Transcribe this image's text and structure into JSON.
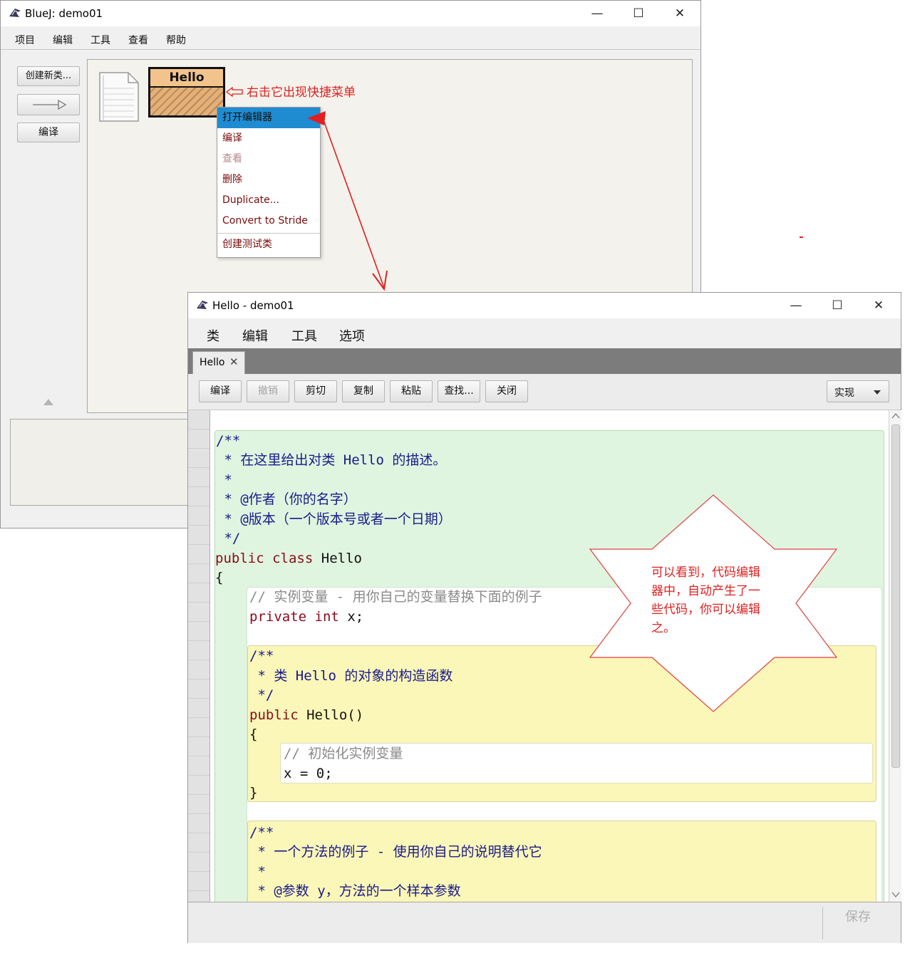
{
  "main_window": {
    "title": "BlueJ:  demo01",
    "menu": [
      "项目",
      "编辑",
      "工具",
      "查看",
      "帮助"
    ],
    "side_buttons": {
      "new_class": "创建新类...",
      "arrow": "—▷",
      "compile": "编译"
    },
    "class_box_label": "Hello"
  },
  "context_menu": {
    "items": [
      {
        "label": "打开编辑器",
        "state": "highlighted"
      },
      {
        "label": "编译",
        "state": "normal"
      },
      {
        "label": "查看",
        "state": "disabled"
      },
      {
        "label": "删除",
        "state": "normal"
      },
      {
        "label": "Duplicate...",
        "state": "normal"
      },
      {
        "label": "Convert to Stride",
        "state": "normal"
      },
      {
        "label": "创建测试类",
        "state": "normal"
      }
    ]
  },
  "annotations": {
    "right_click_note": "右击它出现快捷菜单",
    "star_note_lines": [
      "可以看到，代码编辑",
      "器中，自动产生了一",
      "些代码，你可以编辑",
      "之。"
    ]
  },
  "editor_window": {
    "title": "Hello - demo01",
    "menu": [
      "类",
      "编辑",
      "工具",
      "选项"
    ],
    "tab": "Hello",
    "toolbar": {
      "buttons": [
        "编译",
        "撤销",
        "剪切",
        "复制",
        "粘贴",
        "查找...",
        "关闭"
      ],
      "disabled": [
        "撤销"
      ],
      "view_select": "实现"
    },
    "save_label": "保存",
    "code": {
      "class_comment": [
        "/**",
        " * 在这里给出对类 Hello 的描述。",
        " *",
        " * @作者（你的名字）",
        " * @版本（一个版本号或者一个日期）",
        " */"
      ],
      "class_decl": {
        "kw1": "public",
        "kw2": "class",
        "name": "Hello"
      },
      "open_brace": "{",
      "field_comment": "// 实例变量 - 用你自己的变量替换下面的例子",
      "field_decl": {
        "kw1": "private",
        "kw2": "int",
        "rest": "x;"
      },
      "ctor_comment": [
        "/**",
        " * 类 Hello 的对象的构造函数",
        " */"
      ],
      "ctor_decl": {
        "kw": "public",
        "rest": "Hello()"
      },
      "ctor_open": "{",
      "ctor_body_comment": "// 初始化实例变量",
      "ctor_body_stmt": "x = 0;",
      "ctor_close": "}",
      "method_comment": [
        "/**",
        " * 一个方法的例子 - 使用你自己的说明替代它",
        " *",
        " * @参数 y，方法的一个样本参数"
      ]
    }
  }
}
